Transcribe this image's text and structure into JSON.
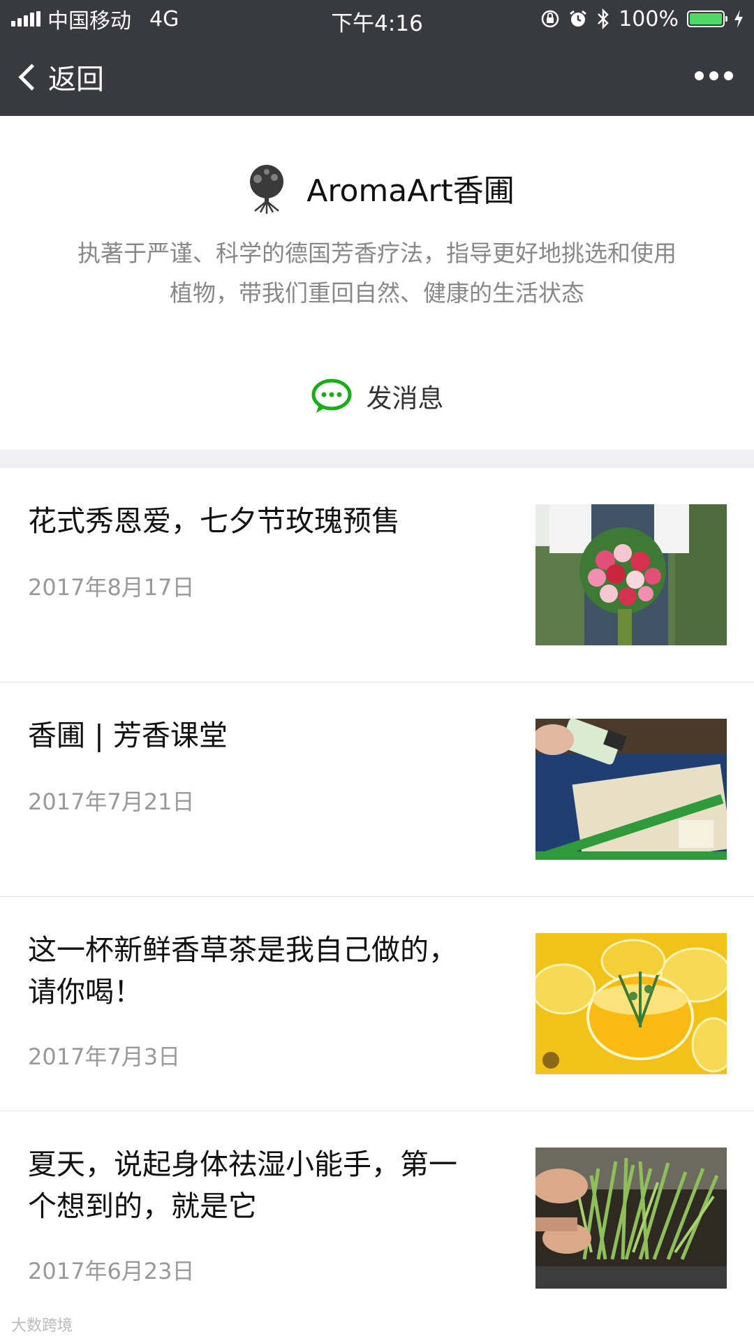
{
  "status_bar": {
    "carrier": "中国移动",
    "network": "4G",
    "time": "下午4:16",
    "battery_text": "100%",
    "battery_level": 1.0,
    "battery_color": "#4cd964"
  },
  "nav": {
    "back_label": "返回",
    "more_icon": "more-icon"
  },
  "account": {
    "name": "AromaArt香圃",
    "logo_icon": "tree-logo-icon",
    "description_line1": "执著于严谨、科学的德国芳香疗法，指导更好地挑选和使用",
    "description_line2": "植物，带我们重回自然、健康的生活状态"
  },
  "send_message": {
    "label": "发消息",
    "icon": "chat-bubble-icon",
    "icon_color": "#1aad19"
  },
  "articles": [
    {
      "title_line1": "花式秀恩爱，七夕节玫瑰预售",
      "title_line2": "",
      "date": "2017年8月17日"
    },
    {
      "title_line1": "香圃 | 芳香课堂",
      "title_line2": "",
      "date": "2017年7月21日"
    },
    {
      "title_line1": "这一杯新鲜香草茶是我自己做的，",
      "title_line2": "请你喝！",
      "date": "2017年7月3日"
    },
    {
      "title_line1": "夏天，说起身体祛湿小能手，第一",
      "title_line2": "个想到的，就是它",
      "date": "2017年6月23日"
    }
  ],
  "watermark": "大数跨境"
}
